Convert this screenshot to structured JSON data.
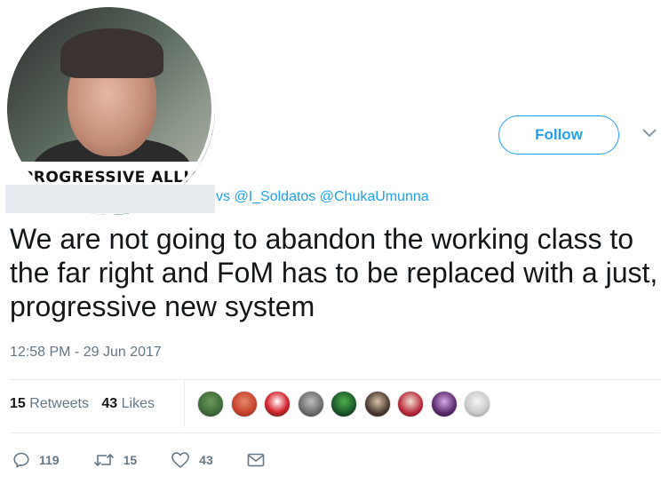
{
  "profile": {
    "avatar_banner_text": "E PROGRESSIVE ALLIAN",
    "stripe_colors": [
      "#f2a93b",
      "#e23a2c",
      "#7ab041",
      "#2d7c3c",
      "#f4c432",
      "#f2a93b"
    ]
  },
  "follow": {
    "label": "Follow"
  },
  "reply": {
    "tail": "vs",
    "handles": "@I_Soldatos @ChukaUmunna"
  },
  "tweet": {
    "text": "We are not going to abandon the working class to the far right and FoM has to be replaced with a just, progressive new system",
    "timestamp": "12:58 PM - 29 Jun 2017"
  },
  "stats": {
    "retweets_count": "15",
    "retweets_label": "Retweets",
    "likes_count": "43",
    "likes_label": "Likes"
  },
  "likers": [
    {
      "color": "#3f6a3a"
    },
    {
      "color": "#c8402b"
    },
    {
      "color": "#d6222c"
    },
    {
      "color": "#6b6b6b"
    },
    {
      "color": "#1e5f2c"
    },
    {
      "color": "#4a3a30"
    },
    {
      "color": "#b9283a"
    },
    {
      "color": "#5a2a6b"
    },
    {
      "color": "#c9c9c9"
    }
  ],
  "actions": {
    "reply_count": "119",
    "retweet_count": "15",
    "like_count": "43"
  },
  "colors": {
    "accent": "#1da1f2",
    "secondary_text": "#657786",
    "primary_text": "#14171a"
  },
  "icons": [
    "reply-icon",
    "retweet-icon",
    "heart-icon",
    "mail-icon",
    "chevron-down-icon"
  ]
}
